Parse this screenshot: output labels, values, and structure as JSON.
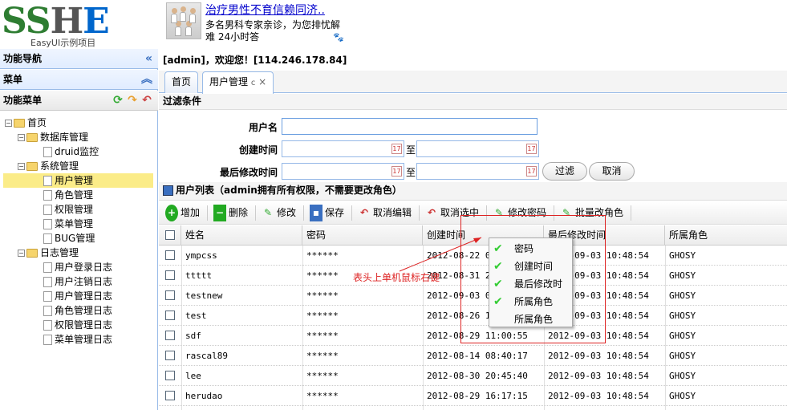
{
  "logo": {
    "main_s": "SS",
    "main_h": "H",
    "main_e": "E",
    "sub": "EasyUI示例项目"
  },
  "ad": {
    "title": "治疗男性不育信赖同济..",
    "line1": "多名男科专家亲诊，为您排忧解",
    "line2": "难 24小时答"
  },
  "left": {
    "nav_title": "功能导航",
    "menu_title": "菜单",
    "func_title": "功能菜单",
    "tree": [
      {
        "label": "首页"
      },
      {
        "label": "数据库管理"
      },
      {
        "label": "druid监控"
      },
      {
        "label": "系统管理"
      },
      {
        "label": "用户管理"
      },
      {
        "label": "角色管理"
      },
      {
        "label": "权限管理"
      },
      {
        "label": "菜单管理"
      },
      {
        "label": "BUG管理"
      },
      {
        "label": "日志管理"
      },
      {
        "label": "用户登录日志"
      },
      {
        "label": "用户注销日志"
      },
      {
        "label": "用户管理日志"
      },
      {
        "label": "角色管理日志"
      },
      {
        "label": "权限管理日志"
      },
      {
        "label": "菜单管理日志"
      }
    ]
  },
  "welcome": "[admin]，欢迎您！[114.246.178.84]",
  "tabs": [
    {
      "label": "首页"
    },
    {
      "label": "用户管理"
    }
  ],
  "filter": {
    "title": "过滤条件",
    "username_label": "用户名",
    "created_label": "创建时间",
    "modified_label": "最后修改时间",
    "to": "至",
    "filter_btn": "过滤",
    "cancel_btn": "取消"
  },
  "list_title": "用户列表（admin拥有所有权限，不需要更改角色）",
  "toolbar": {
    "add": "增加",
    "delete": "删除",
    "edit": "修改",
    "save": "保存",
    "cancel_edit": "取消编辑",
    "unselect": "取消选中",
    "change_pwd": "修改密码",
    "batch_role": "批量改角色"
  },
  "grid": {
    "columns": [
      "姓名",
      "密码",
      "创建时间",
      "最后修改时间",
      "所属角色"
    ],
    "rows": [
      {
        "name": "ympcss",
        "pwd": "******",
        "created": "2012-08-22 02",
        "modified": "2012-09-03 10:48:54",
        "role": "GHOSY"
      },
      {
        "name": "ttttt",
        "pwd": "******",
        "created": "2012-08-31 23",
        "modified": "2012-09-03 10:48:54",
        "role": "GHOSY"
      },
      {
        "name": "testnew",
        "pwd": "******",
        "created": "2012-09-03 01",
        "modified": "2012-09-03 10:48:54",
        "role": "GHOSY"
      },
      {
        "name": "test",
        "pwd": "******",
        "created": "2012-08-26 16",
        "modified": "2012-09-03 10:48:54",
        "role": "GHOSY"
      },
      {
        "name": "sdf",
        "pwd": "******",
        "created": "2012-08-29 11:00:55",
        "modified": "2012-09-03 10:48:54",
        "role": "GHOSY"
      },
      {
        "name": "rascal89",
        "pwd": "******",
        "created": "2012-08-14 08:40:17",
        "modified": "2012-09-03 10:48:54",
        "role": "GHOSY"
      },
      {
        "name": "lee",
        "pwd": "******",
        "created": "2012-08-30 20:45:40",
        "modified": "2012-09-03 10:48:54",
        "role": "GHOSY"
      },
      {
        "name": "herudao",
        "pwd": "******",
        "created": "2012-08-29 16:17:15",
        "modified": "2012-09-03 10:48:54",
        "role": "GHOSY"
      }
    ]
  },
  "context_menu": [
    {
      "label": "密码",
      "checked": true
    },
    {
      "label": "创建时间",
      "checked": true
    },
    {
      "label": "最后修改时",
      "checked": true
    },
    {
      "label": "所属角色",
      "checked": true
    },
    {
      "label": "所属角色",
      "checked": false
    }
  ],
  "annotation": "表头上单机鼠标右键"
}
